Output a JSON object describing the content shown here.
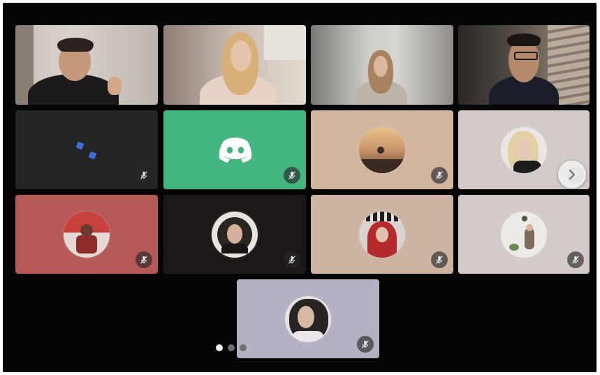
{
  "colors": {
    "stage_bg": "#050505",
    "discord_green": "#43b581",
    "tile_dark": "#242424",
    "tile_peach": "#d3b6a0",
    "tile_light": "#d2cbc8",
    "tile_red": "#b65958",
    "tile_dark2": "#1c1818",
    "tile_tan": "#cdb4a2",
    "tile_lavender": "#b5b1c3"
  },
  "participants": [
    {
      "kind": "video",
      "icon": "camera-feed"
    },
    {
      "kind": "video",
      "icon": "camera-feed"
    },
    {
      "kind": "video",
      "icon": "camera-feed"
    },
    {
      "kind": "video",
      "icon": "camera-feed"
    },
    {
      "kind": "avatar",
      "icon": "blue-dots-avatar",
      "muted": true
    },
    {
      "kind": "avatar",
      "icon": "discord-logo-icon",
      "muted": true
    },
    {
      "kind": "avatar",
      "icon": "sunset-avatar",
      "muted": true
    },
    {
      "kind": "avatar",
      "icon": "photo-avatar",
      "muted": true
    },
    {
      "kind": "avatar",
      "icon": "photo-avatar",
      "muted": true
    },
    {
      "kind": "avatar",
      "icon": "photo-avatar",
      "muted": true
    },
    {
      "kind": "avatar",
      "icon": "photo-avatar",
      "muted": true
    },
    {
      "kind": "avatar",
      "icon": "photo-avatar",
      "muted": true
    },
    {
      "kind": "avatar",
      "icon": "photo-avatar",
      "muted": true
    }
  ],
  "navigation": {
    "next_icon": "chevron-right-icon",
    "pages": 3,
    "current_page": 1
  }
}
